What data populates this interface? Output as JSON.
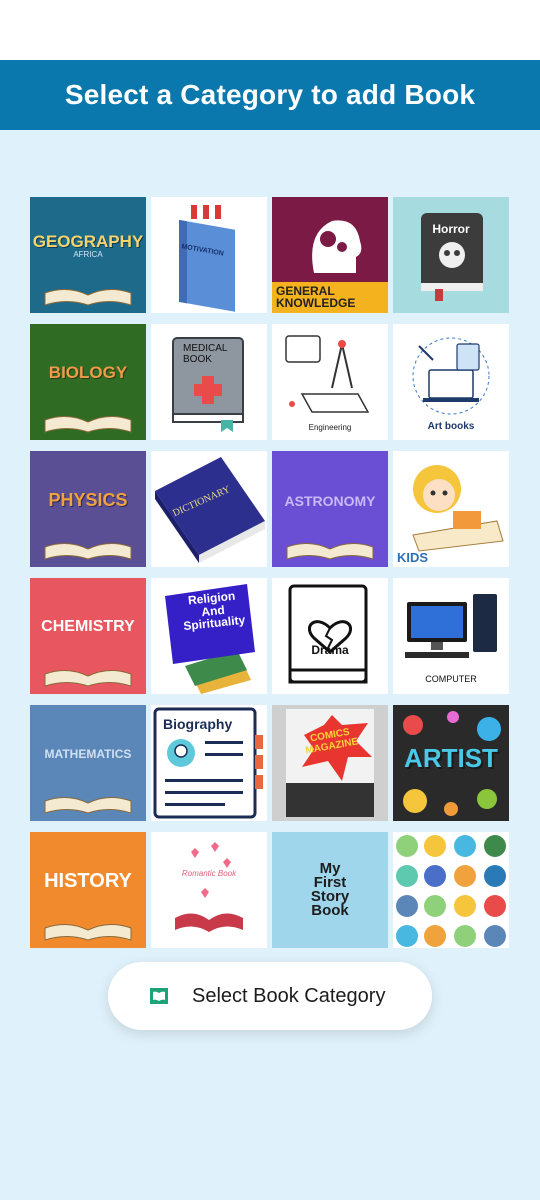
{
  "header": {
    "title": "Select a Category to add Book"
  },
  "categories": [
    {
      "label": "GEOGRAPHY",
      "sub": "AFRICA"
    },
    {
      "label": "MOTIVATION"
    },
    {
      "label": "GENERAL\nKNOWLEDGE"
    },
    {
      "label": "Horror"
    },
    {
      "label": "BIOLOGY"
    },
    {
      "label": "MEDICAL\nBOOK"
    },
    {
      "label": "Engineering"
    },
    {
      "label": "Art books"
    },
    {
      "label": "PHYSICS"
    },
    {
      "label": "DICTIONARY"
    },
    {
      "label": "ASTRONOMY"
    },
    {
      "label": "KIDS"
    },
    {
      "label": "CHEMISTRY"
    },
    {
      "label": "Religion\nAnd\nSpirituality"
    },
    {
      "label": "Drama"
    },
    {
      "label": "COMPUTER"
    },
    {
      "label": "MATHEMATICS"
    },
    {
      "label": "Biography"
    },
    {
      "label": "COMICS\nMAGAZINE"
    },
    {
      "label": "ARTIST"
    },
    {
      "label": "HISTORY"
    },
    {
      "label": "Romantic Book"
    },
    {
      "label": "My\nFirst\nStory\nBook"
    },
    {
      "label": ""
    }
  ],
  "select_button": {
    "label": "Select Book Category",
    "icon": "open-book-icon"
  },
  "colors": {
    "header_bg": "#0b78ad",
    "page_bg": "#dff1fa"
  }
}
